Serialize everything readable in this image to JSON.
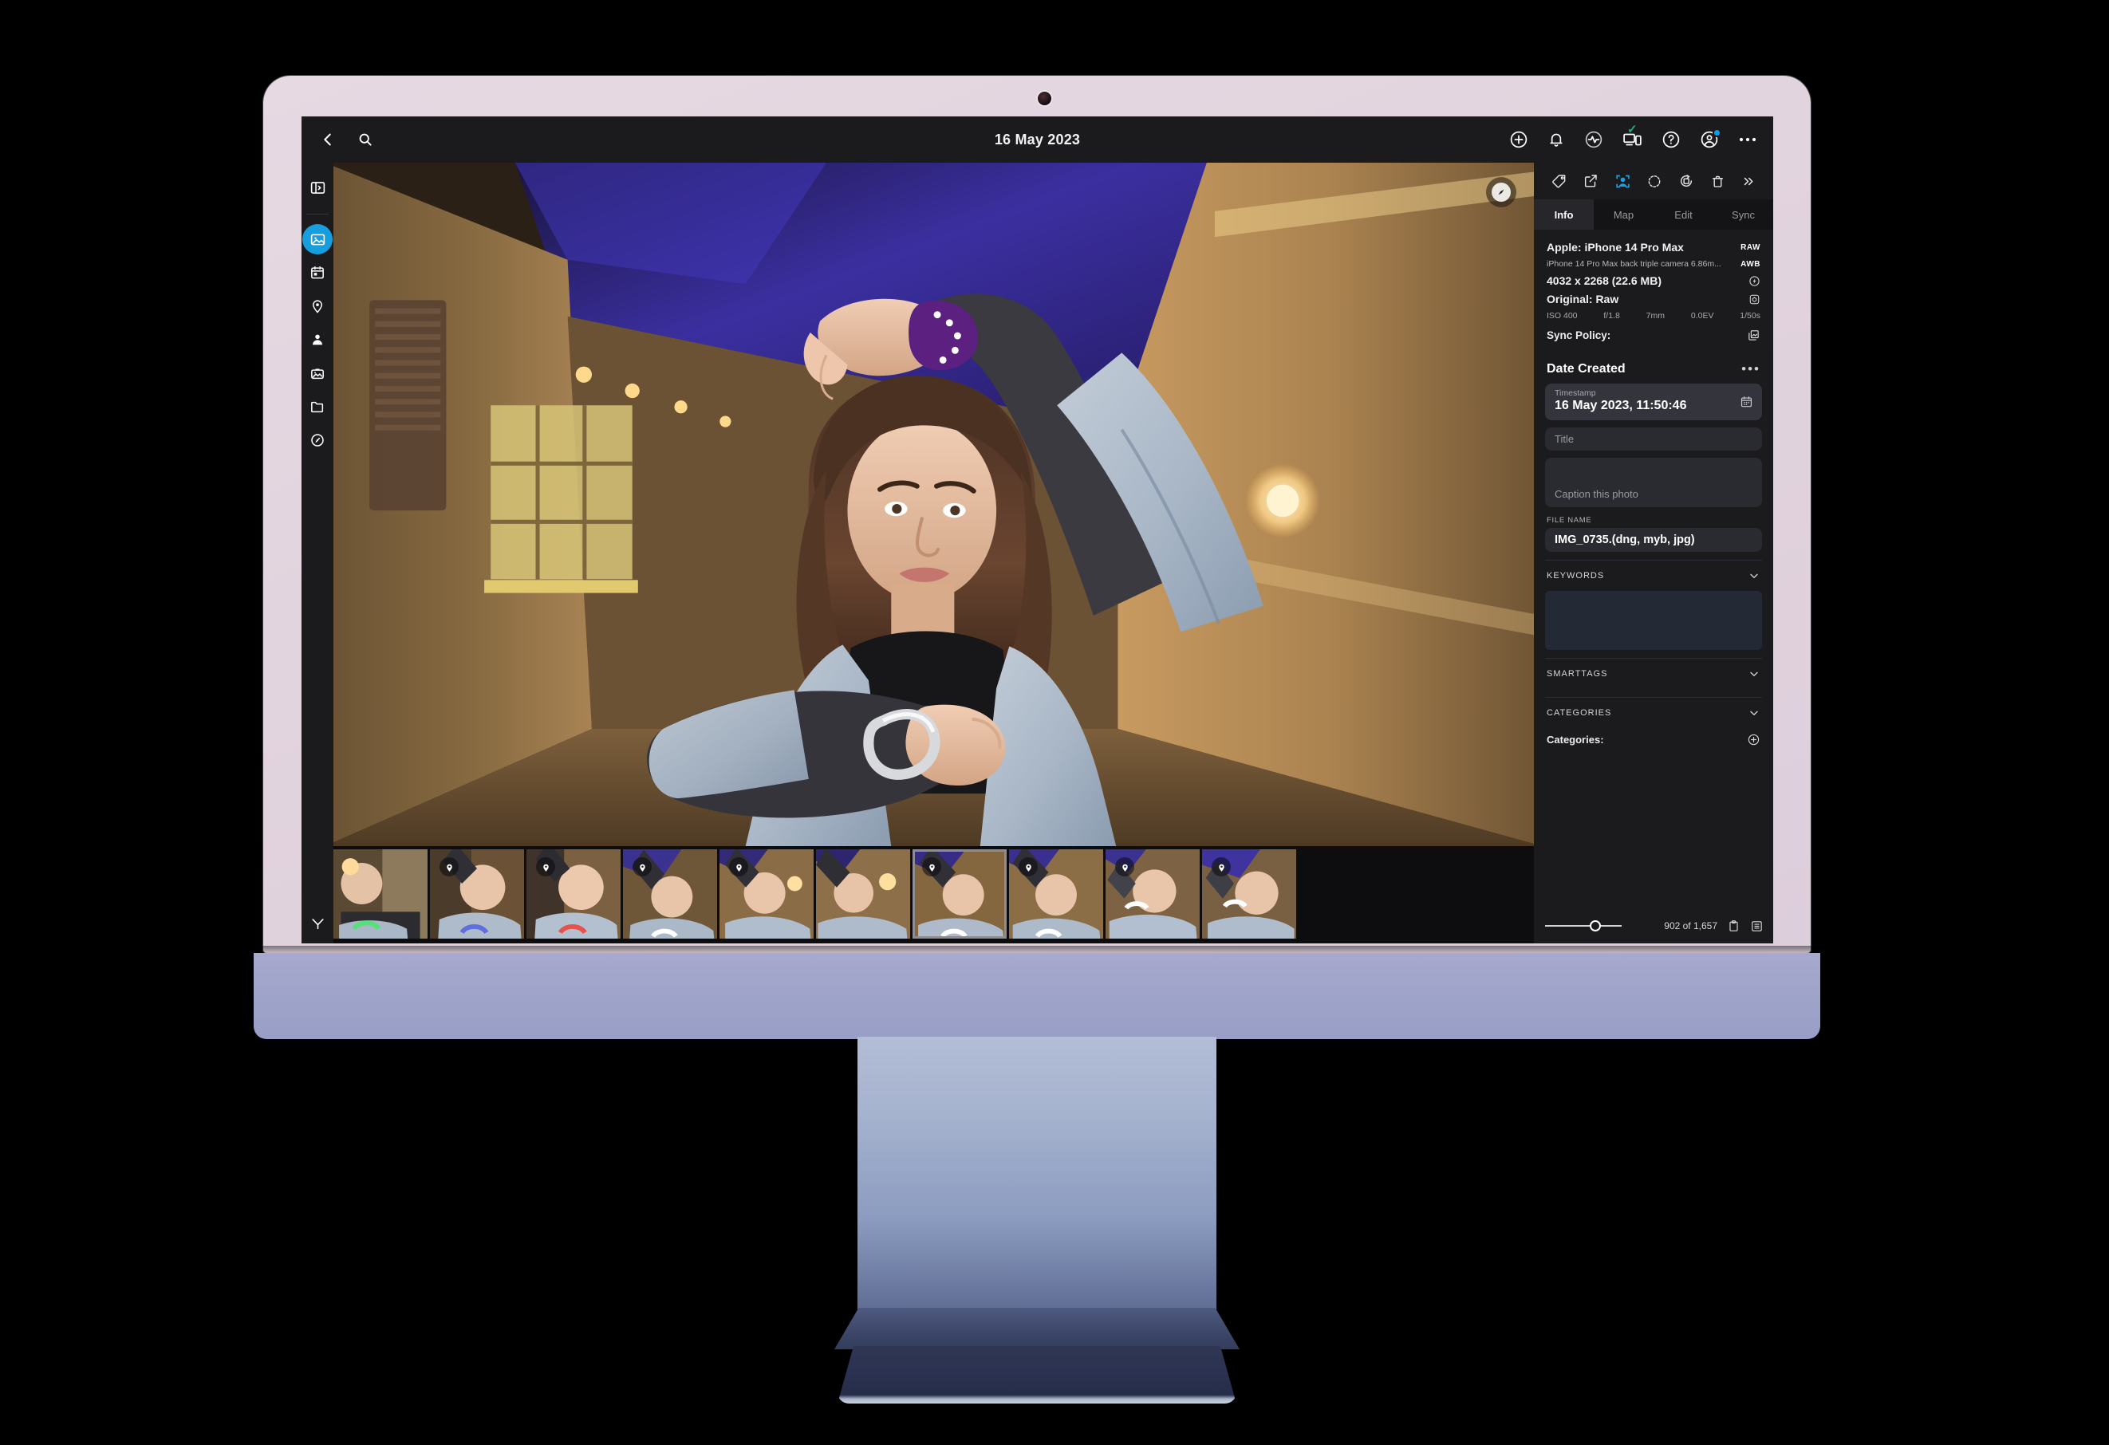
{
  "device": {
    "kind": "imac-desktop"
  },
  "app": {
    "topbar": {
      "back_icon": "chevron-left-icon",
      "search_icon": "search-icon",
      "title": "16 May 2023",
      "right_icons": [
        {
          "name": "add-icon",
          "label": "Add"
        },
        {
          "name": "notifications-bell-icon",
          "label": "Notifications"
        },
        {
          "name": "activity-icon",
          "label": "Activity"
        },
        {
          "name": "devices-sync-icon",
          "label": "Devices"
        },
        {
          "name": "help-icon",
          "label": "Help"
        },
        {
          "name": "account-avatar-icon",
          "label": "Account"
        },
        {
          "name": "more-options-icon",
          "label": "More"
        }
      ]
    },
    "sidebar": {
      "items": [
        {
          "name": "toggle-panel-icon",
          "label": "Toggle Panel",
          "active": false
        },
        {
          "name": "all-photos-icon",
          "label": "All Photos",
          "active": true
        },
        {
          "name": "calendar-icon",
          "label": "Calendar",
          "active": false
        },
        {
          "name": "places-pin-icon",
          "label": "Places",
          "active": false
        },
        {
          "name": "people-icon",
          "label": "People",
          "active": false
        },
        {
          "name": "albums-icon",
          "label": "Albums",
          "active": false
        },
        {
          "name": "folders-icon",
          "label": "Folders",
          "active": false
        },
        {
          "name": "performance-icon",
          "label": "Performance",
          "active": false
        }
      ],
      "filter_icon": "filter-funnel-icon"
    },
    "viewer": {
      "navigator_icon": "compass-navigator-icon"
    },
    "filmstrip": {
      "selected_index": 6,
      "thumbnails": [
        {
          "pin": false,
          "tint": "#4e5a3a"
        },
        {
          "pin": true,
          "tint": "#6a4a6e"
        },
        {
          "pin": true,
          "tint": "#7a3f42"
        },
        {
          "pin": true,
          "tint": "#3f3f6e"
        },
        {
          "pin": true,
          "tint": "#5a4a34"
        },
        {
          "pin": false,
          "tint": "#6b5236"
        },
        {
          "pin": true,
          "tint": "#43386b"
        },
        {
          "pin": true,
          "tint": "#4b3e6a"
        },
        {
          "pin": true,
          "tint": "#5a4d7a"
        },
        {
          "pin": true,
          "tint": "#4d3f72"
        }
      ]
    },
    "right_panel": {
      "tools": [
        {
          "name": "tag-icon",
          "label": "Tag",
          "active": false
        },
        {
          "name": "share-export-icon",
          "label": "Share",
          "active": false
        },
        {
          "name": "people-tag-icon",
          "label": "People Tag",
          "active": true
        },
        {
          "name": "rotate-left-icon",
          "label": "Rotate Left",
          "active": false
        },
        {
          "name": "crop-rotate-icon",
          "label": "Crop & Rotate",
          "active": false
        },
        {
          "name": "delete-trash-icon",
          "label": "Delete",
          "active": false
        },
        {
          "name": "more-chevrons-icon",
          "label": "More",
          "active": false
        }
      ],
      "tabs": [
        {
          "label": "Info",
          "active": true
        },
        {
          "label": "Map",
          "active": false
        },
        {
          "label": "Edit",
          "active": false
        },
        {
          "label": "Sync",
          "active": false
        }
      ],
      "info": {
        "camera": "Apple: iPhone 14 Pro Max",
        "lens": "iPhone 14 Pro Max back triple camera 6.86m...",
        "dimensions": "4032 x 2268 (22.6 MB)",
        "original": "Original: Raw",
        "badge_raw": "RAW",
        "badge_awb": "AWB",
        "flash_icon": "flash-off-icon",
        "metering_icon": "metering-mode-icon",
        "exif": {
          "iso": "ISO 400",
          "aperture": "f/1.8",
          "focal": "7mm",
          "exposure_bias": "0.0EV",
          "shutter": "1/50s"
        },
        "sync_policy_label": "Sync Policy:",
        "sync_policy_icon": "stacked-images-icon"
      },
      "date_created": {
        "heading": "Date Created",
        "more_icon": "more-dots-icon",
        "timestamp_label": "Timestamp",
        "timestamp_value": "16 May 2023, 11:50:46",
        "calendar_icon": "calendar-picker-icon"
      },
      "title_field": {
        "placeholder": "Title",
        "value": ""
      },
      "caption_field": {
        "placeholder": "Caption this photo",
        "value": ""
      },
      "file_name": {
        "label": "FILE NAME",
        "value": "IMG_0735.(dng, myb, jpg)"
      },
      "accordions": [
        {
          "label": "KEYWORDS",
          "chevron": "chevron-down-icon"
        },
        {
          "label": "SMARTTAGS",
          "chevron": "chevron-down-icon"
        },
        {
          "label": "CATEGORIES",
          "chevron": "chevron-down-icon"
        }
      ],
      "categories": {
        "label": "Categories:",
        "add_icon": "add-circle-icon"
      }
    },
    "statusbar": {
      "zoom_slider_icon": "thumbnail-size-slider",
      "count": "902 of 1,657",
      "clipboard_icon": "clipboard-icon",
      "list-view_icon": "list-view-icon"
    },
    "colors": {
      "accent": "#169fdc",
      "panel_bg": "#1b1b1d",
      "app_bg": "#111113",
      "field_bg": "#2a2a31",
      "keyword_bg": "#232a35",
      "bezel": "#e2d4de",
      "chin": "#9ea3c9",
      "base": "#2a3150",
      "check_green": "#18b07e",
      "badge_blue": "#0d9ce8"
    }
  }
}
